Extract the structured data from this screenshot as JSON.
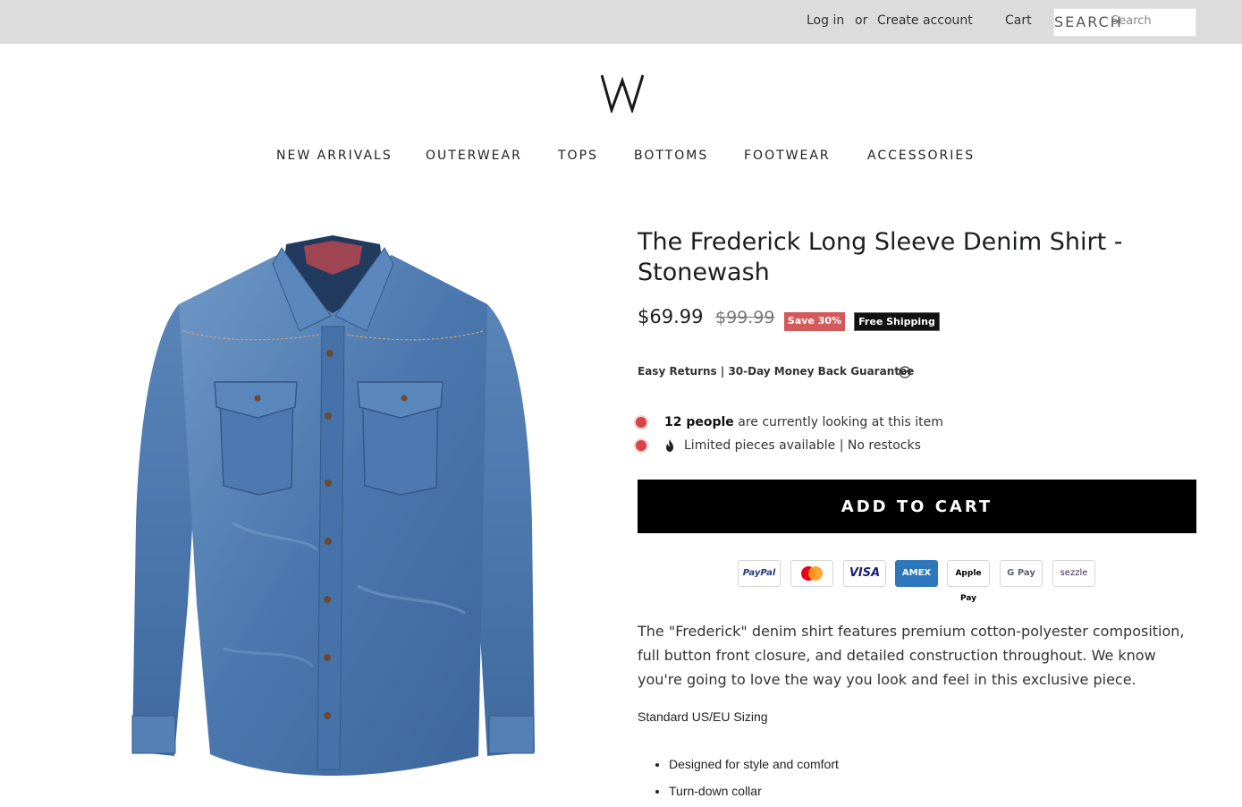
{
  "topbar": {
    "login_label": "Log in",
    "or_label": "or",
    "create_account_label": "Create account",
    "cart_label": "Cart",
    "search_button_label": "SEARCH",
    "search_placeholder": "Search"
  },
  "logo": {
    "letter": "W"
  },
  "nav": {
    "items": [
      {
        "label": "NEW ARRIVALS"
      },
      {
        "label": "OUTERWEAR"
      },
      {
        "label": "TOPS"
      },
      {
        "label": "BOTTOMS"
      },
      {
        "label": "FOOTWEAR"
      },
      {
        "label": "ACCESSORIES"
      }
    ]
  },
  "product": {
    "title": "The Frederick Long Sleeve Denim Shirt - Stonewash",
    "price": "$69.99",
    "compare_price": "$99.99",
    "save_badge": "Save 30%",
    "shipping_badge": "Free Shipping",
    "guarantee": "Easy Returns | 30-Day Money Back Guarantee",
    "viewers_count": "12 people",
    "viewers_text": " are currently looking at this item",
    "stock_text": "Limited pieces available | No restocks",
    "add_to_cart_label": "ADD TO CART",
    "description": "The \"Frederick\" denim shirt features premium cotton-polyester composition, full button front closure, and detailed construction throughout. We know you're going to love the way you look and feel in this exclusive piece.",
    "sizing": "Standard US/EU Sizing",
    "features": [
      "Designed for style and comfort",
      "Turn-down collar"
    ]
  },
  "payments": [
    {
      "label": "PayPal",
      "color": "#253b80"
    },
    {
      "label": "mastercard",
      "color": "#eb001b"
    },
    {
      "label": "VISA",
      "color": "#1a1f71"
    },
    {
      "label": "AMEX",
      "color": "#2e77bc"
    },
    {
      "label": "Apple Pay",
      "color": "#000000"
    },
    {
      "label": "G Pay",
      "color": "#5f6368"
    },
    {
      "label": "sezzle",
      "color": "#392558"
    }
  ],
  "colors": {
    "topbar_bg": "#dcdcdc",
    "accent_red": "#d25a5a",
    "denim": "#4a77ad"
  }
}
